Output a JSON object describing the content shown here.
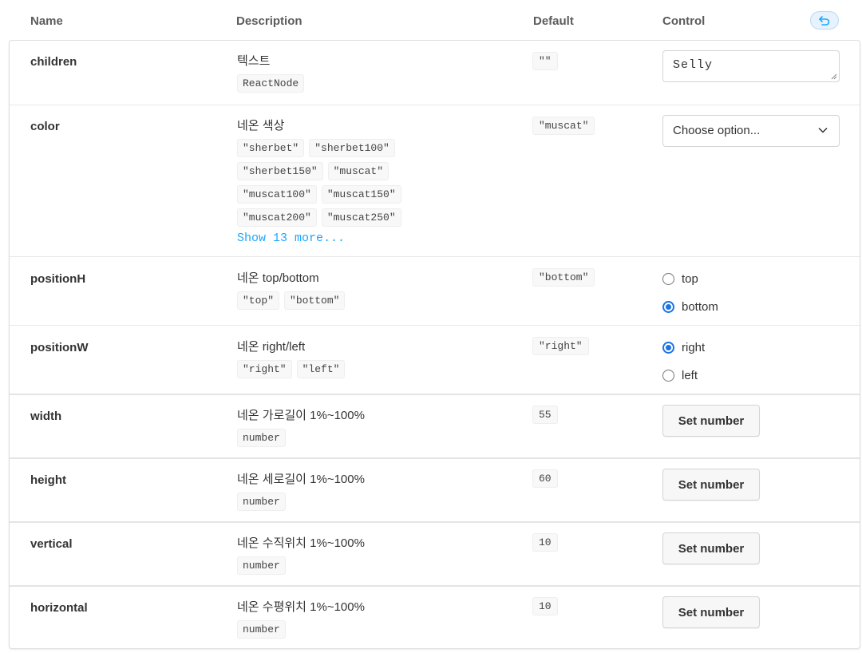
{
  "columns": {
    "name": "Name",
    "description": "Description",
    "default": "Default",
    "control": "Control"
  },
  "reset_icon": "undo-arrow-icon",
  "colors": {
    "accent": "#1ea7fd",
    "radio": "#1a73e8"
  },
  "rows": {
    "children": {
      "name": "children",
      "description": "텍스트",
      "types": [
        "ReactNode"
      ],
      "default": "\"\"",
      "control": {
        "type": "textarea",
        "value": "Selly"
      }
    },
    "color": {
      "name": "color",
      "description": "네온 색상",
      "types": [
        "\"sherbet\"",
        "\"sherbet100\"",
        "\"sherbet150\"",
        "\"muscat\"",
        "\"muscat100\"",
        "\"muscat150\"",
        "\"muscat200\"",
        "\"muscat250\""
      ],
      "show_more": "Show 13 more...",
      "default": "\"muscat\"",
      "control": {
        "type": "select",
        "value": "Choose option..."
      }
    },
    "positionH": {
      "name": "positionH",
      "description": "네온 top/bottom",
      "types": [
        "\"top\"",
        "\"bottom\""
      ],
      "default": "\"bottom\"",
      "control": {
        "type": "radio",
        "options": [
          "top",
          "bottom"
        ],
        "selected": "bottom"
      }
    },
    "positionW": {
      "name": "positionW",
      "description": "네온 right/left",
      "types": [
        "\"right\"",
        "\"left\""
      ],
      "default": "\"right\"",
      "control": {
        "type": "radio",
        "options": [
          "right",
          "left"
        ],
        "selected": "right"
      }
    },
    "width": {
      "name": "width",
      "description": "네온 가로길이 1%~100%",
      "types": [
        "number"
      ],
      "default": "55",
      "control": {
        "type": "button",
        "label": "Set number"
      }
    },
    "height": {
      "name": "height",
      "description": "네온 세로길이 1%~100%",
      "types": [
        "number"
      ],
      "default": "60",
      "control": {
        "type": "button",
        "label": "Set number"
      }
    },
    "vertical": {
      "name": "vertical",
      "description": "네온 수직위치 1%~100%",
      "types": [
        "number"
      ],
      "default": "10",
      "control": {
        "type": "button",
        "label": "Set number"
      }
    },
    "horizontal": {
      "name": "horizontal",
      "description": "네온 수평위치 1%~100%",
      "types": [
        "number"
      ],
      "default": "10",
      "control": {
        "type": "button",
        "label": "Set number"
      }
    }
  }
}
